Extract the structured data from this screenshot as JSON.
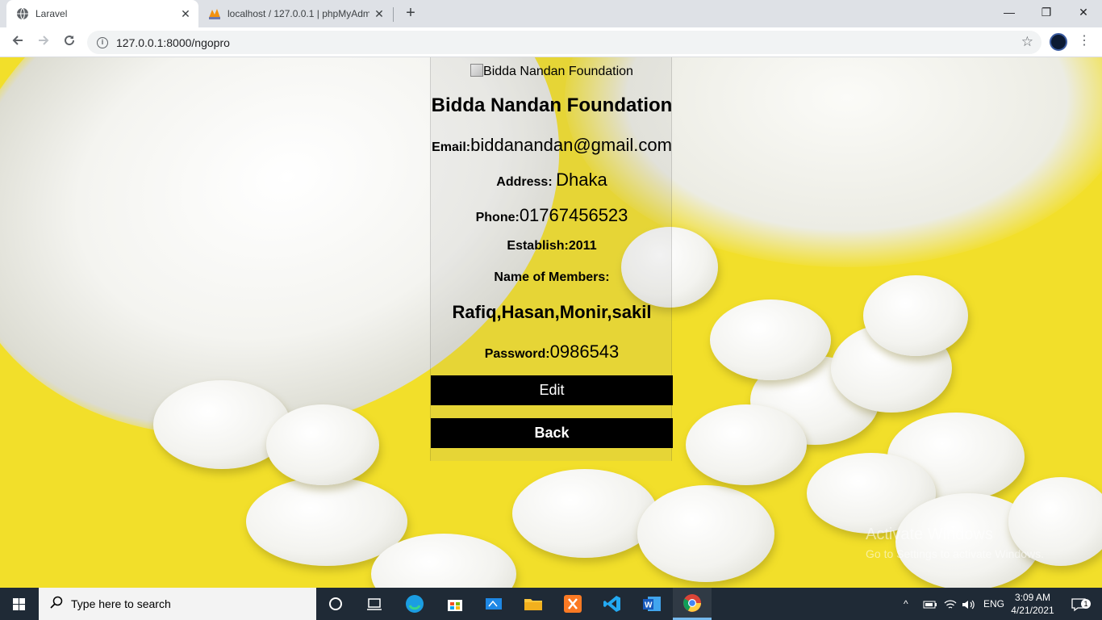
{
  "browser": {
    "tabs": [
      {
        "title": "Laravel",
        "close": "✕"
      },
      {
        "title": "localhost / 127.0.0.1 | phpMyAdm",
        "close": "✕"
      }
    ],
    "new_tab": "+",
    "window_controls": {
      "minimize": "—",
      "restore": "❐",
      "close": "✕"
    },
    "url": "127.0.0.1:8000/ngopro"
  },
  "page": {
    "logo_alt": "Bidda Nandan Foundation",
    "org_name": "Bidda Nandan Foundation",
    "email_label": "Email:",
    "email_value": "biddanandan@gmail.com",
    "address_label": "Address:",
    "address_value": "Dhaka",
    "phone_label": "Phone:",
    "phone_value": "01767456523",
    "establish_label": "Establish:",
    "establish_value": "2011",
    "members_label": "Name of Members:",
    "members_value": "Rafiq,Hasan,Monir,sakil",
    "password_label": "Password:",
    "password_value": "0986543",
    "edit_button": "Edit",
    "back_button": "Back"
  },
  "watermark": {
    "line1": "Activate Windows",
    "line2": "Go to Settings to activate Windows."
  },
  "taskbar": {
    "search_placeholder": "Type here to search",
    "language": "ENG",
    "time": "3:09 AM",
    "date": "4/21/2021",
    "notification_count": "1"
  }
}
